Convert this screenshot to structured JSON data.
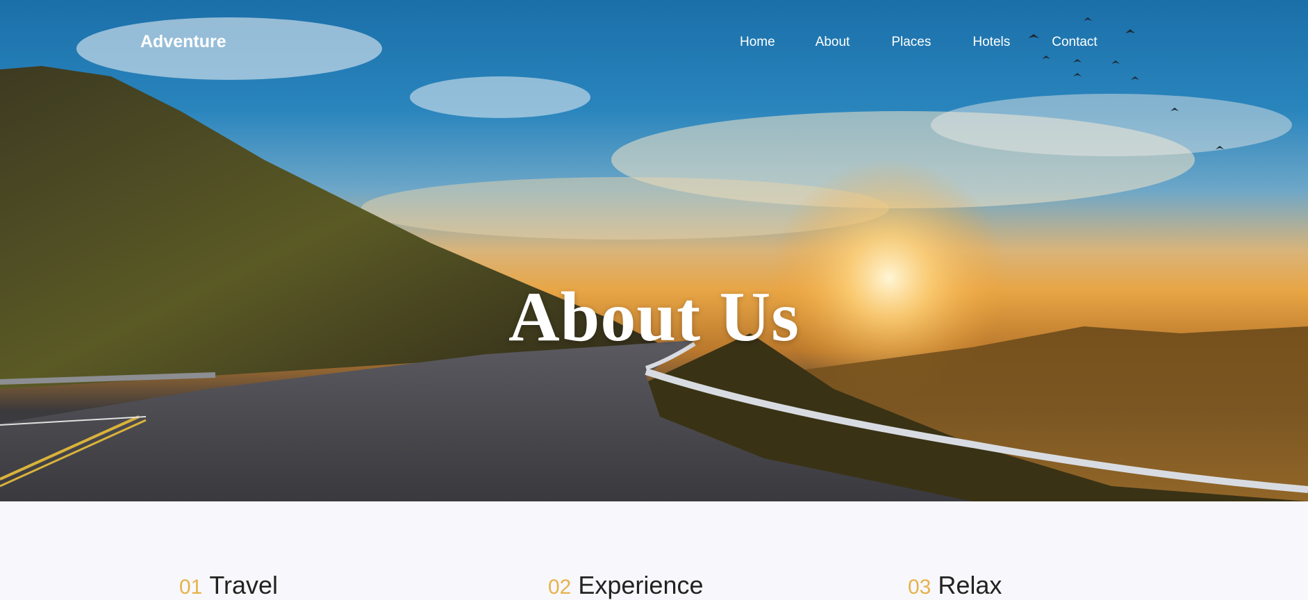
{
  "brand": "Adventure",
  "nav": {
    "items": [
      {
        "label": "Home"
      },
      {
        "label": "About"
      },
      {
        "label": "Places"
      },
      {
        "label": "Hotels"
      },
      {
        "label": "Contact"
      }
    ]
  },
  "hero": {
    "title": "About Us",
    "image": "mountain-road-sunset-image"
  },
  "features": [
    {
      "number": "01",
      "title": "Travel"
    },
    {
      "number": "02",
      "title": "Experience"
    },
    {
      "number": "03",
      "title": "Relax"
    }
  ],
  "colors": {
    "accent": "#e6b24c",
    "page_bg": "#f8f8fc",
    "nav_text": "#ffffff"
  }
}
